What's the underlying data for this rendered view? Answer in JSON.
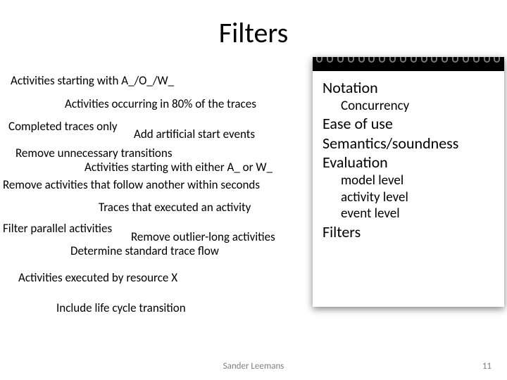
{
  "title": "Filters",
  "left": {
    "l1": "Activities starting with A_/O_/W_",
    "l2": "Activities occurring in 80% of the traces",
    "l3": "Completed traces only",
    "l4": "Add artificial start events",
    "l5": "Remove unnecessary transitions",
    "l6": "Activities starting with either A_ or W_",
    "l7": "Remove activities that follow another within seconds",
    "l8": "Traces that executed an activity",
    "l9": "Filter parallel activities",
    "l10": "Remove outlier-long activities",
    "l11": "Determine standard trace flow",
    "l12": "Activities executed by resource X",
    "l13": "Include life cycle transition"
  },
  "right": {
    "r1": "Notation",
    "r2": "Concurrency",
    "r3": "Ease of use",
    "r4": "Semantics/soundness",
    "r5": "Evaluation",
    "r6": "model level",
    "r7": "activity level",
    "r8": "event level",
    "r9": "Filters"
  },
  "footer": {
    "author": "Sander Leemans",
    "page": "11"
  }
}
